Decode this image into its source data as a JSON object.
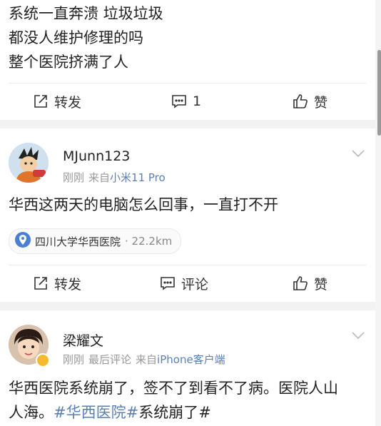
{
  "post1": {
    "lines": [
      "系统一直奔溃 垃圾垃圾",
      "都没人维护修理的吗",
      "整个医院挤满了人"
    ],
    "actions": {
      "repost": "转发",
      "comment_count": "1",
      "like": "赞"
    }
  },
  "post2": {
    "username": "MJunn123",
    "time": "刚刚",
    "source_prefix": "来自",
    "source": "小米11 Pro",
    "text": "华西这两天的电脑怎么回事，一直打不开",
    "location": {
      "name": "四川大学华西医院",
      "distance": "· 22.2km"
    },
    "actions": {
      "repost": "转发",
      "comment": "评论",
      "like": "赞"
    }
  },
  "post3": {
    "username": "梁耀文",
    "time": "刚刚",
    "last_comment": "最后评论",
    "source_prefix": "来自",
    "source": "iPhone客户端",
    "text_line1": "华西医院系统崩了，签不了到看不了病。医院人山",
    "text_line2_plain": "人海。",
    "hashtag1": "#华西医院#",
    "hashtag2": "系统崩了#"
  },
  "colors": {
    "link": "#5b7fb5",
    "meta": "#999999",
    "divider": "#eeeeee",
    "background_gap": "#f2f2f2"
  },
  "icons": [
    "repost-icon",
    "comment-icon",
    "like-icon",
    "location-pin-icon",
    "chevron-down-icon",
    "verified-badge-icon"
  ]
}
